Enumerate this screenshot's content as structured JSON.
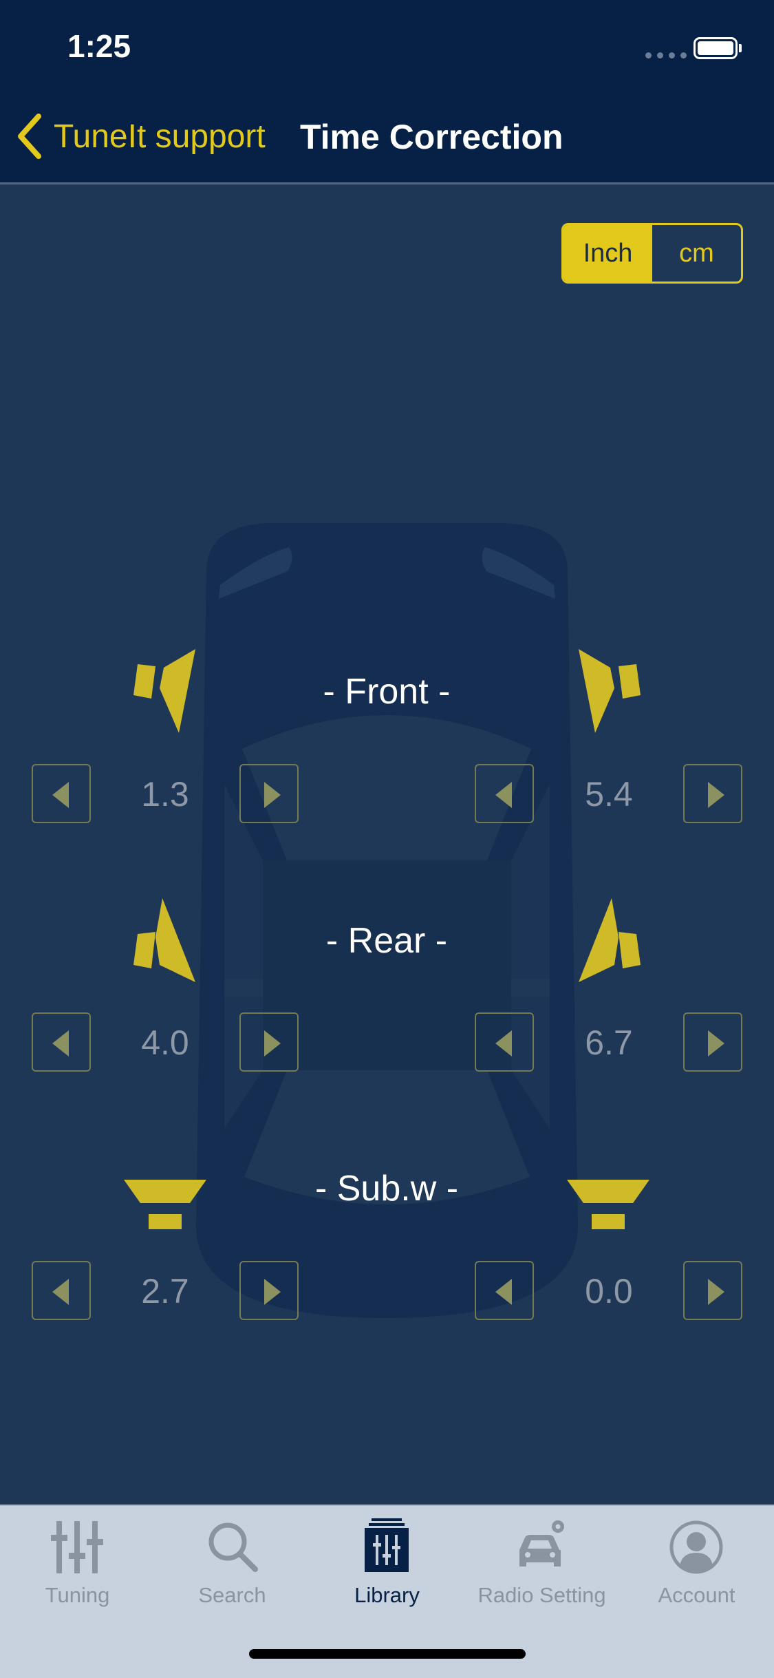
{
  "status_bar": {
    "time": "1:25"
  },
  "nav": {
    "back_label": "TuneIt support",
    "title": "Time Correction"
  },
  "units": {
    "options": [
      "Inch",
      "cm"
    ],
    "selected": "Inch"
  },
  "sections": {
    "front": {
      "label": "- Front -",
      "left_value": "1.3",
      "right_value": "5.4"
    },
    "rear": {
      "label": "- Rear -",
      "left_value": "4.0",
      "right_value": "6.7"
    },
    "sub": {
      "label": "- Sub.w -",
      "left_value": "2.7",
      "right_value": "0.0"
    }
  },
  "tabs": [
    {
      "label": "Tuning",
      "icon": "sliders-icon",
      "active": false
    },
    {
      "label": "Search",
      "icon": "search-icon",
      "active": false
    },
    {
      "label": "Library",
      "icon": "library-icon",
      "active": true
    },
    {
      "label": "Radio Setting",
      "icon": "car-settings-icon",
      "active": false
    },
    {
      "label": "Account",
      "icon": "account-icon",
      "active": false
    }
  ],
  "colors": {
    "accent": "#e2c91b",
    "header_bg": "#062046",
    "page_bg": "#1f3757",
    "car": "#152d50",
    "tabbar_bg": "#c7d2de"
  }
}
